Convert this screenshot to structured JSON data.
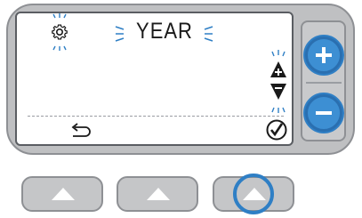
{
  "display": {
    "mode_label": "YEAR"
  },
  "colors": {
    "highlight": "#2f7fc5",
    "body": "#bfc0c2",
    "screen": "#ffffff"
  },
  "icons": {
    "settings": "gear-icon",
    "back": "return-arrow-icon",
    "confirm": "checkmark-icon",
    "up_down": "up-down-arrows-icon",
    "plus": "plus-icon",
    "minus": "minus-icon",
    "soft_button": "triangle-up-icon"
  }
}
